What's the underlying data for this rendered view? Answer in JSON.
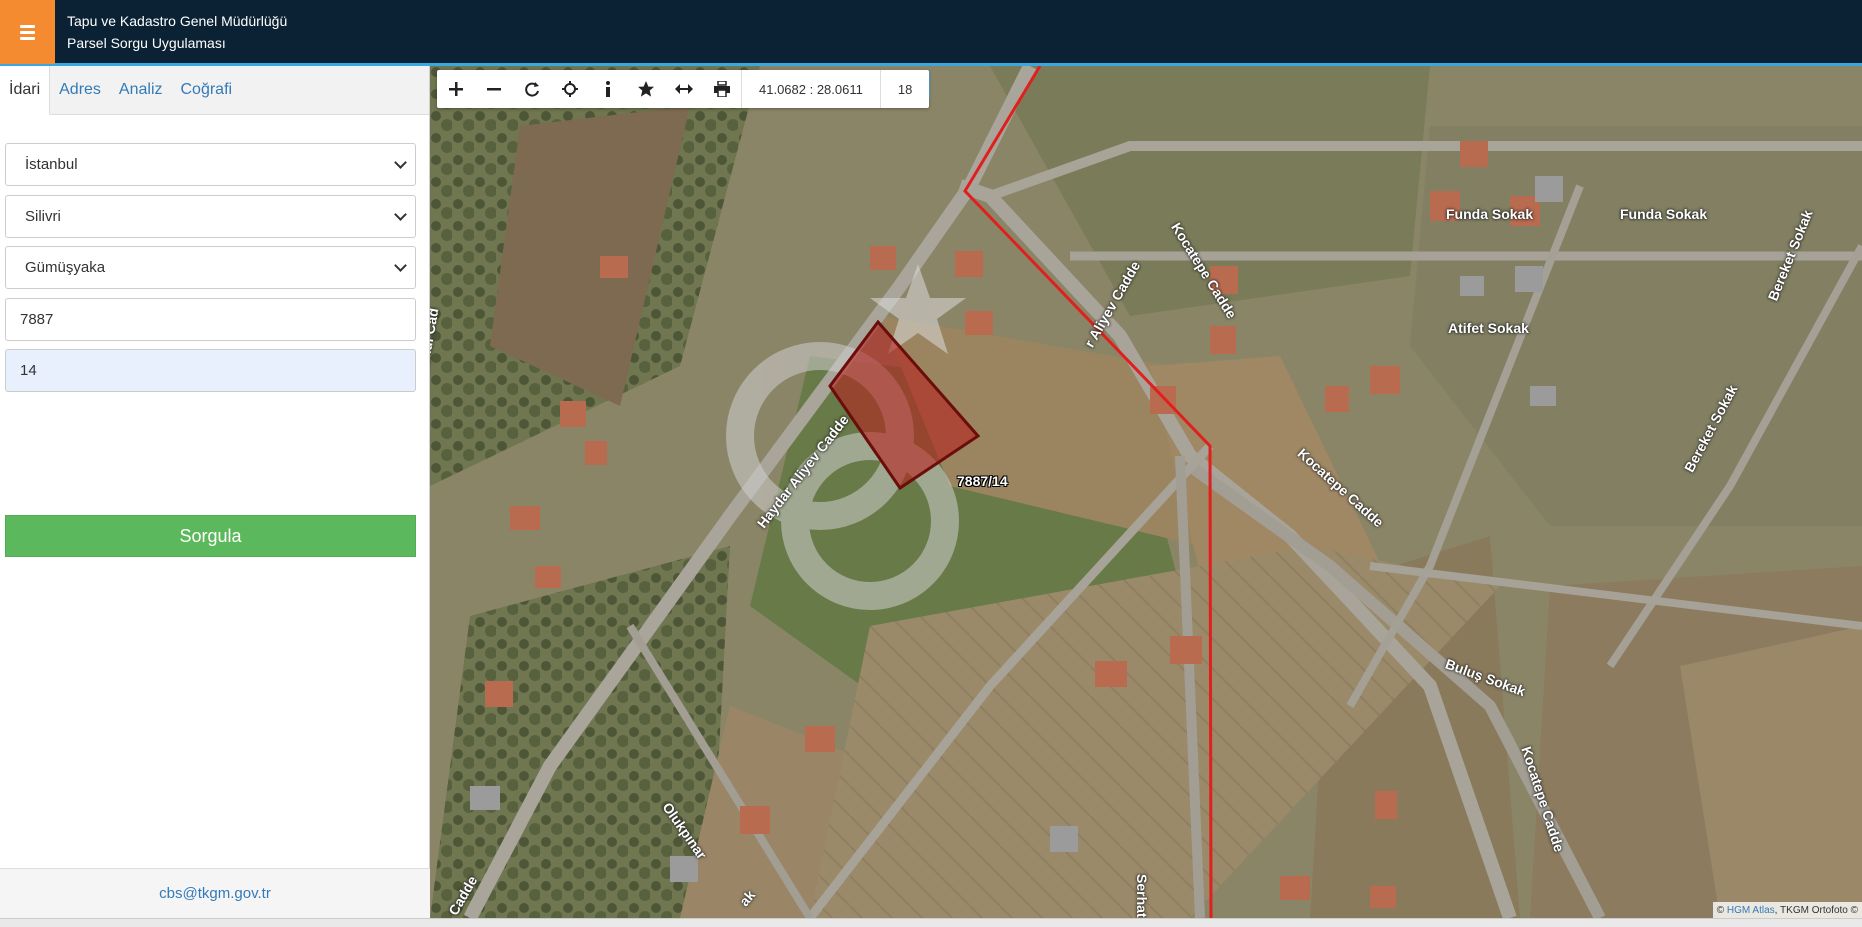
{
  "header": {
    "title_line1": "Tapu ve Kadastro Genel Müdürlüğü",
    "title_line2": "Parsel Sorgu Uygulaması",
    "menu_icon": "hamburger-icon"
  },
  "tabs": [
    {
      "label": "İdari",
      "active": true
    },
    {
      "label": "Adres",
      "active": false
    },
    {
      "label": "Analiz",
      "active": false
    },
    {
      "label": "Coğrafi",
      "active": false
    }
  ],
  "form": {
    "province": "İstanbul",
    "district": "Silivri",
    "neighborhood": "Gümüşyaka",
    "block": "7887",
    "parcel": "14",
    "submit_label": "Sorgula"
  },
  "footer": {
    "email": "cbs@tkgm.gov.tr"
  },
  "toolbar": {
    "tools": [
      "zoom-in-icon",
      "zoom-out-icon",
      "refresh-icon",
      "locate-icon",
      "info-icon",
      "star-icon",
      "measure-icon",
      "print-icon"
    ],
    "coordinates": "41.0682 : 28.0611",
    "zoom_level": "18"
  },
  "map": {
    "parcel_label": "7887/14",
    "streets": {
      "funda1": "Funda Sokak",
      "funda2": "Funda Sokak",
      "bereket1": "Bereket Sokak",
      "bereket2": "Bereket Sokak",
      "atifet": "Atifet Sokak",
      "kocatepe1": "Kocatepe Cadde",
      "kocatepe2": "Kocatepe Cadde",
      "kocatepe3": "Kocatepe Cadde",
      "aliyev1": "r Aliyev Cadde",
      "aliyev2": "Haydar Aliyev Cadde",
      "bulus": "Buluş Sokak",
      "serhat": "Serhat Cadde",
      "olukpinar": "Olukpınar",
      "sokak_bottom": "ak",
      "cadde_bottom": "Cadde",
      "dakul": "dakul Cad"
    },
    "attribution_prefix": "©",
    "attribution_link": "HGM Atlas",
    "attribution_rest": ", TKGM Ortofoto ©"
  },
  "colors": {
    "header_bg": "#0b2234",
    "menu_bg": "#f58b31",
    "accent_line": "#3aa8e0",
    "submit_bg": "#5cb85c",
    "parcel_fill": "#b5221f",
    "boundary_line": "#e0201e"
  }
}
